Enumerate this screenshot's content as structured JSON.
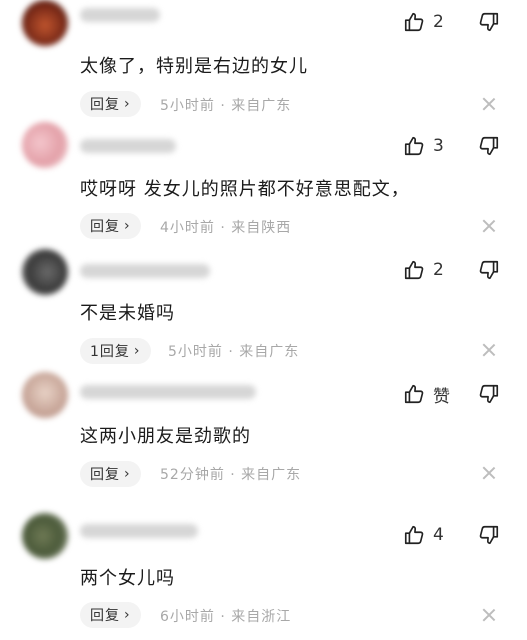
{
  "comments": [
    {
      "like_count": "2",
      "text": "太像了，特别是右边的女儿",
      "reply_label": "回复",
      "meta": "5小时前 · 来自广东",
      "avatar_color": "#7a2a18"
    },
    {
      "like_count": "3",
      "text": "哎呀呀 发女儿的照片都不好意思配文，",
      "reply_label": "回复",
      "meta": "4小时前 · 来自陕西",
      "avatar_color": "#e3a0a8"
    },
    {
      "like_count": "2",
      "text": "不是未婚吗",
      "reply_label": "1回复",
      "meta": "5小时前 · 来自广东",
      "avatar_color": "#3a3a3a"
    },
    {
      "like_count": "赞",
      "text": "这两小朋友是劲歌的",
      "reply_label": "回复",
      "meta": "52分钟前 · 来自广东",
      "avatar_color": "#c9a89b"
    },
    {
      "like_count": "4",
      "text": "两个女儿吗",
      "reply_label": "回复",
      "meta": "6小时前 · 来自浙江",
      "avatar_color": "#4b5a3a"
    }
  ]
}
